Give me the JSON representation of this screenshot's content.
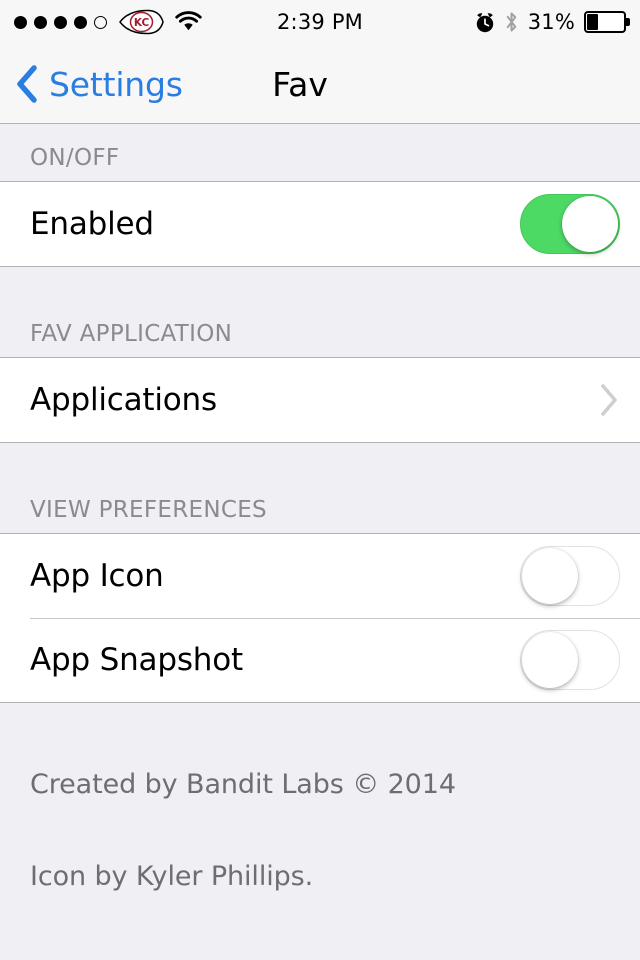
{
  "status_bar": {
    "signal_dots_total": 5,
    "signal_dots_filled": 4,
    "carrier_icon": "kansas-city-chiefs-arrowhead-logo",
    "wifi_icon": "wifi-icon",
    "time": "2:39 PM",
    "alarm_icon": "alarm-clock-icon",
    "bluetooth_icon": "bluetooth-icon",
    "battery_percent_label": "31%",
    "battery_level": 31,
    "battery_icon": "battery-icon"
  },
  "nav_bar": {
    "back_icon": "chevron-left-icon",
    "back_label": "Settings",
    "title": "Fav"
  },
  "sections": [
    {
      "header": "ON/OFF",
      "rows": [
        {
          "label": "Enabled",
          "control": "switch",
          "value": true
        }
      ]
    },
    {
      "header": "FAV APPLICATION",
      "rows": [
        {
          "label": "Applications",
          "control": "disclosure",
          "accessory_icon": "chevron-right-icon"
        }
      ]
    },
    {
      "header": "VIEW PREFERENCES",
      "rows": [
        {
          "label": "App Icon",
          "control": "switch",
          "value": false
        },
        {
          "label": "App Snapshot",
          "control": "switch",
          "value": false
        }
      ]
    }
  ],
  "footer": {
    "line1": "Created by Bandit Labs © 2014",
    "line2": "Icon by Kyler Phillips."
  },
  "colors": {
    "tint_blue": "#2a7de1",
    "switch_on_green": "#4cd964",
    "group_background": "#efeff4",
    "cell_background": "#ffffff",
    "header_text": "#8a8a8f",
    "footer_text": "#6d6d72",
    "separator": "#c8c7cc",
    "carrier_logo_red": "#a6192e"
  }
}
